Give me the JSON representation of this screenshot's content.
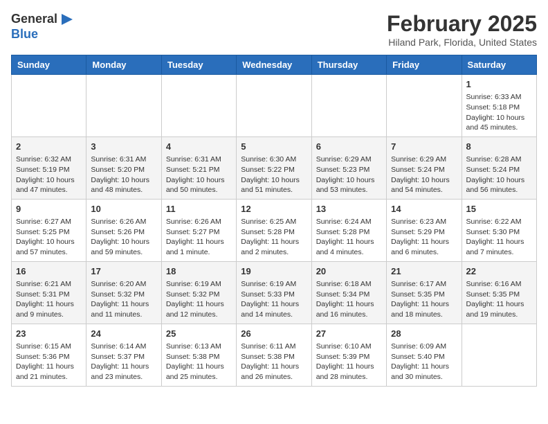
{
  "header": {
    "logo_line1": "General",
    "logo_line2": "Blue",
    "month_year": "February 2025",
    "location": "Hiland Park, Florida, United States"
  },
  "days_of_week": [
    "Sunday",
    "Monday",
    "Tuesday",
    "Wednesday",
    "Thursday",
    "Friday",
    "Saturday"
  ],
  "weeks": [
    [
      {
        "day": "",
        "info": ""
      },
      {
        "day": "",
        "info": ""
      },
      {
        "day": "",
        "info": ""
      },
      {
        "day": "",
        "info": ""
      },
      {
        "day": "",
        "info": ""
      },
      {
        "day": "",
        "info": ""
      },
      {
        "day": "1",
        "info": "Sunrise: 6:33 AM\nSunset: 5:18 PM\nDaylight: 10 hours and 45 minutes."
      }
    ],
    [
      {
        "day": "2",
        "info": "Sunrise: 6:32 AM\nSunset: 5:19 PM\nDaylight: 10 hours and 47 minutes."
      },
      {
        "day": "3",
        "info": "Sunrise: 6:31 AM\nSunset: 5:20 PM\nDaylight: 10 hours and 48 minutes."
      },
      {
        "day": "4",
        "info": "Sunrise: 6:31 AM\nSunset: 5:21 PM\nDaylight: 10 hours and 50 minutes."
      },
      {
        "day": "5",
        "info": "Sunrise: 6:30 AM\nSunset: 5:22 PM\nDaylight: 10 hours and 51 minutes."
      },
      {
        "day": "6",
        "info": "Sunrise: 6:29 AM\nSunset: 5:23 PM\nDaylight: 10 hours and 53 minutes."
      },
      {
        "day": "7",
        "info": "Sunrise: 6:29 AM\nSunset: 5:24 PM\nDaylight: 10 hours and 54 minutes."
      },
      {
        "day": "8",
        "info": "Sunrise: 6:28 AM\nSunset: 5:24 PM\nDaylight: 10 hours and 56 minutes."
      }
    ],
    [
      {
        "day": "9",
        "info": "Sunrise: 6:27 AM\nSunset: 5:25 PM\nDaylight: 10 hours and 57 minutes."
      },
      {
        "day": "10",
        "info": "Sunrise: 6:26 AM\nSunset: 5:26 PM\nDaylight: 10 hours and 59 minutes."
      },
      {
        "day": "11",
        "info": "Sunrise: 6:26 AM\nSunset: 5:27 PM\nDaylight: 11 hours and 1 minute."
      },
      {
        "day": "12",
        "info": "Sunrise: 6:25 AM\nSunset: 5:28 PM\nDaylight: 11 hours and 2 minutes."
      },
      {
        "day": "13",
        "info": "Sunrise: 6:24 AM\nSunset: 5:28 PM\nDaylight: 11 hours and 4 minutes."
      },
      {
        "day": "14",
        "info": "Sunrise: 6:23 AM\nSunset: 5:29 PM\nDaylight: 11 hours and 6 minutes."
      },
      {
        "day": "15",
        "info": "Sunrise: 6:22 AM\nSunset: 5:30 PM\nDaylight: 11 hours and 7 minutes."
      }
    ],
    [
      {
        "day": "16",
        "info": "Sunrise: 6:21 AM\nSunset: 5:31 PM\nDaylight: 11 hours and 9 minutes."
      },
      {
        "day": "17",
        "info": "Sunrise: 6:20 AM\nSunset: 5:32 PM\nDaylight: 11 hours and 11 minutes."
      },
      {
        "day": "18",
        "info": "Sunrise: 6:19 AM\nSunset: 5:32 PM\nDaylight: 11 hours and 12 minutes."
      },
      {
        "day": "19",
        "info": "Sunrise: 6:19 AM\nSunset: 5:33 PM\nDaylight: 11 hours and 14 minutes."
      },
      {
        "day": "20",
        "info": "Sunrise: 6:18 AM\nSunset: 5:34 PM\nDaylight: 11 hours and 16 minutes."
      },
      {
        "day": "21",
        "info": "Sunrise: 6:17 AM\nSunset: 5:35 PM\nDaylight: 11 hours and 18 minutes."
      },
      {
        "day": "22",
        "info": "Sunrise: 6:16 AM\nSunset: 5:35 PM\nDaylight: 11 hours and 19 minutes."
      }
    ],
    [
      {
        "day": "23",
        "info": "Sunrise: 6:15 AM\nSunset: 5:36 PM\nDaylight: 11 hours and 21 minutes."
      },
      {
        "day": "24",
        "info": "Sunrise: 6:14 AM\nSunset: 5:37 PM\nDaylight: 11 hours and 23 minutes."
      },
      {
        "day": "25",
        "info": "Sunrise: 6:13 AM\nSunset: 5:38 PM\nDaylight: 11 hours and 25 minutes."
      },
      {
        "day": "26",
        "info": "Sunrise: 6:11 AM\nSunset: 5:38 PM\nDaylight: 11 hours and 26 minutes."
      },
      {
        "day": "27",
        "info": "Sunrise: 6:10 AM\nSunset: 5:39 PM\nDaylight: 11 hours and 28 minutes."
      },
      {
        "day": "28",
        "info": "Sunrise: 6:09 AM\nSunset: 5:40 PM\nDaylight: 11 hours and 30 minutes."
      },
      {
        "day": "",
        "info": ""
      }
    ]
  ]
}
